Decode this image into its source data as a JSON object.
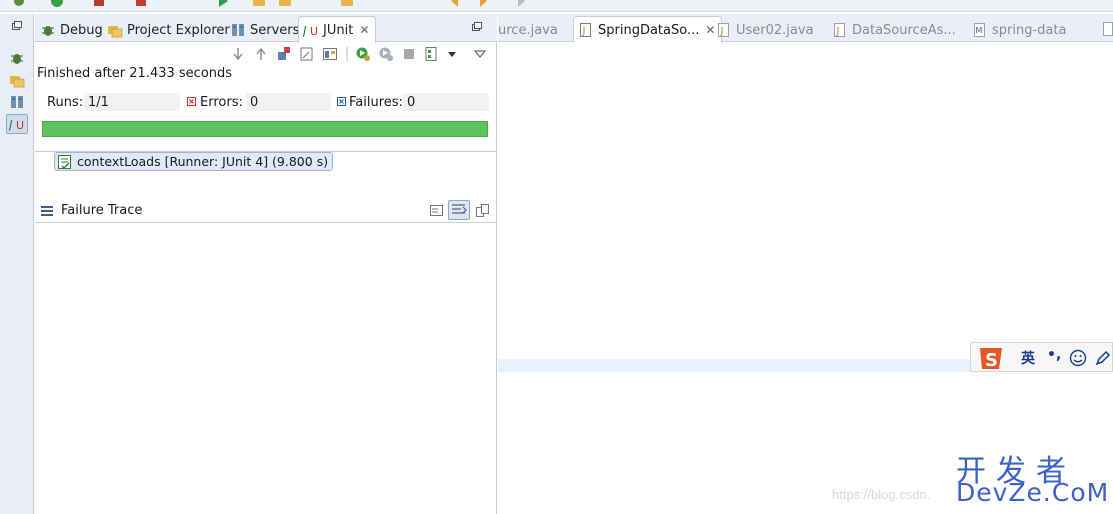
{
  "view_tabs": [
    {
      "label": "Debug",
      "icon": "bug-icon"
    },
    {
      "label": "Project Explorer",
      "icon": "folder-icon"
    },
    {
      "label": "Servers",
      "icon": "servers-icon"
    },
    {
      "label": "JUnit",
      "icon": "junit-icon",
      "active": true
    }
  ],
  "junit": {
    "status": "Finished after 21.433 seconds",
    "runs_label": "Runs:",
    "runs_value": "1/1",
    "errors_label": "Errors:",
    "errors_value": "0",
    "failures_label": "Failures:",
    "failures_value": "0",
    "progress_fraction": 1.0,
    "progress_color": "#5ec45e",
    "test_item": "contextLoads [Runner: JUnit 4] (9.800 s)",
    "failure_trace_title": "Failure Trace"
  },
  "editor_tabs": [
    {
      "label": "urce.java",
      "active": false
    },
    {
      "label": "SpringDataSo...",
      "active": true
    },
    {
      "label": "User02.java",
      "active": false
    },
    {
      "label": "DataSourceAs...",
      "active": false
    },
    {
      "label": "spring-data",
      "active": false
    }
  ],
  "ime": {
    "lang": "英",
    "punct": "•,"
  },
  "watermark": {
    "url": "https://blog.csdn.",
    "cn": "开发者",
    "en": "DevZe.CoM"
  },
  "colors": {
    "accent": "#3d62c6",
    "ime_logo": "#e2572b"
  }
}
